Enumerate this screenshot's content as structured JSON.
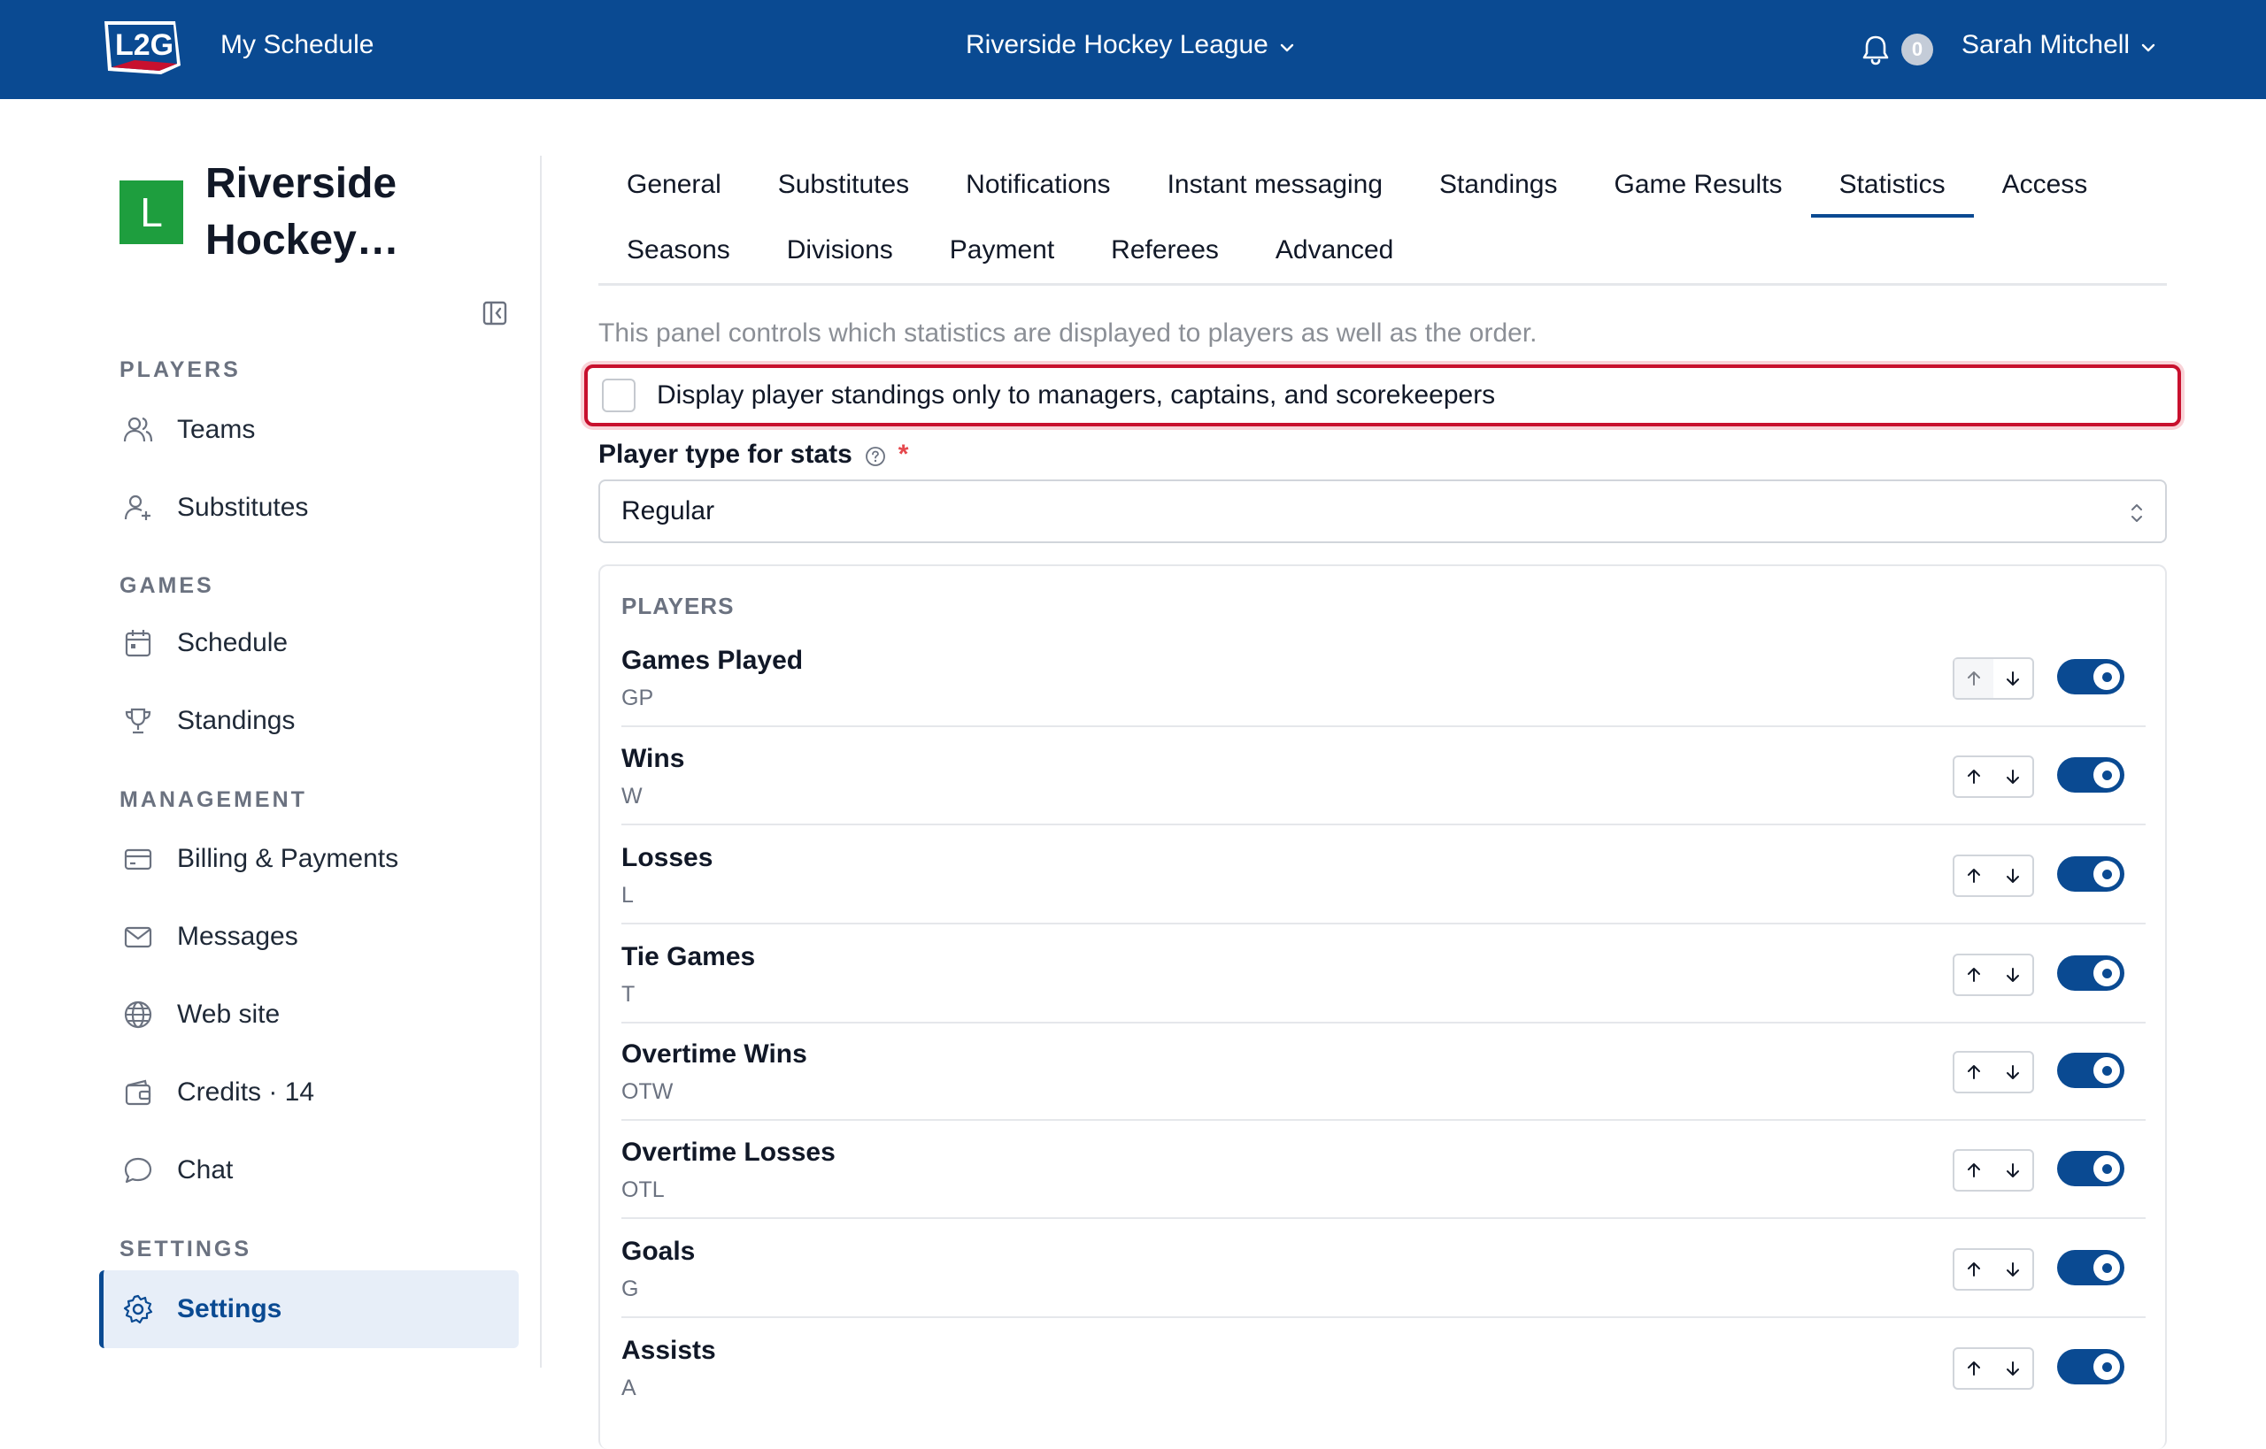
{
  "header": {
    "logo_icon": "l2g-logo",
    "logo_text": "L2G",
    "my_schedule": "My Schedule",
    "league_name": "Riverside Hockey League",
    "notification_count": "0",
    "user_name": "Sarah Mitchell"
  },
  "sidebar": {
    "org_initial": "L",
    "org_name_line1": "Riverside",
    "org_name_line2": "Hockey…",
    "sections": {
      "players": "PLAYERS",
      "games": "GAMES",
      "management": "MANAGEMENT",
      "settings": "SETTINGS"
    },
    "items": {
      "teams": "Teams",
      "substitutes": "Substitutes",
      "schedule": "Schedule",
      "standings": "Standings",
      "billing": "Billing & Payments",
      "messages": "Messages",
      "website": "Web site",
      "credits": "Credits · 14",
      "chat": "Chat",
      "settings": "Settings"
    },
    "active_item": "Settings"
  },
  "tabs": {
    "row1": [
      "General",
      "Substitutes",
      "Notifications",
      "Instant messaging",
      "Standings",
      "Game Results",
      "Statistics",
      "Access"
    ],
    "row2": [
      "Seasons",
      "Divisions",
      "Payment",
      "Referees",
      "Advanced"
    ],
    "active": "Statistics"
  },
  "panel": {
    "description": "This panel controls which statistics are displayed to players as well as the order.",
    "checkbox_label": "Display player standings only to managers, captains, and scorekeepers",
    "checkbox_checked": false,
    "player_type_label": "Player type for stats",
    "required_mark": "*",
    "player_type_value": "Regular"
  },
  "stats": {
    "heading": "PLAYERS",
    "rows": [
      {
        "name": "Games Played",
        "abbr": "GP",
        "enabled": true
      },
      {
        "name": "Wins",
        "abbr": "W",
        "enabled": true
      },
      {
        "name": "Losses",
        "abbr": "L",
        "enabled": true
      },
      {
        "name": "Tie Games",
        "abbr": "T",
        "enabled": true
      },
      {
        "name": "Overtime Wins",
        "abbr": "OTW",
        "enabled": true
      },
      {
        "name": "Overtime Losses",
        "abbr": "OTL",
        "enabled": true
      },
      {
        "name": "Goals",
        "abbr": "G",
        "enabled": true
      },
      {
        "name": "Assists",
        "abbr": "A",
        "enabled": true
      }
    ]
  },
  "colors": {
    "brand": "#0a4a92",
    "org_avatar": "#1e9e3e",
    "highlight_border": "#c8102e"
  }
}
